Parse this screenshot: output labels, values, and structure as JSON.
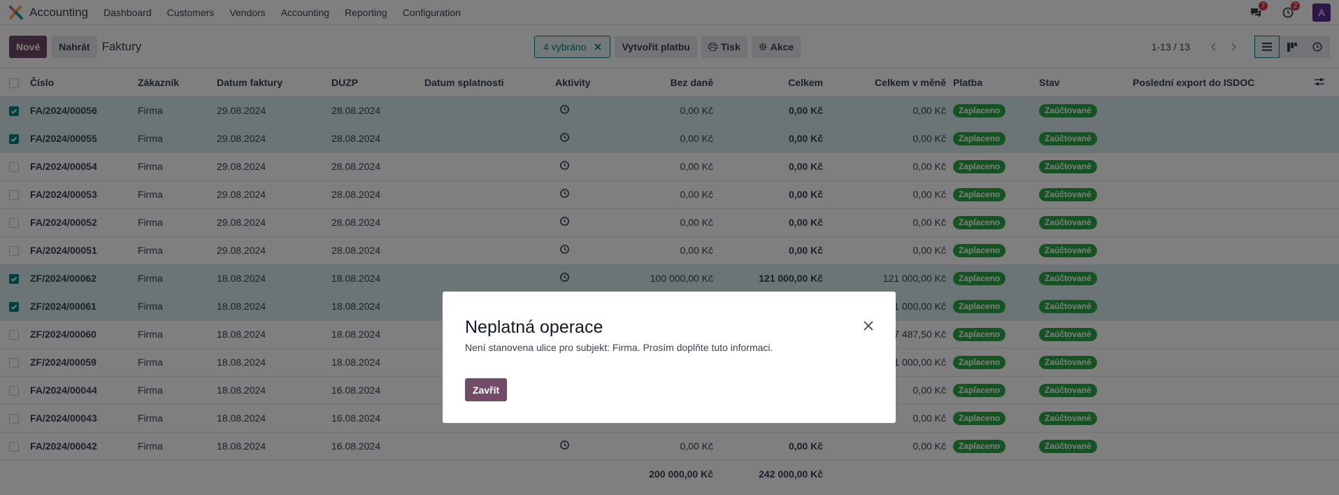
{
  "navbar": {
    "app_name": "Accounting",
    "menu": [
      "Dashboard",
      "Customers",
      "Vendors",
      "Accounting",
      "Reporting",
      "Configuration"
    ],
    "messages_count": "7",
    "activities_count": "2",
    "avatar_letter": "A"
  },
  "control": {
    "new_label": "Nové",
    "upload_label": "Nahrát",
    "breadcrumb": "Faktury",
    "selected_label": "4 vybráno",
    "create_payment_label": "Vytvořit platbu",
    "print_label": "Tisk",
    "action_label": "Akce",
    "pager": "1-13 / 13"
  },
  "table": {
    "columns": [
      "Číslo",
      "Zákazník",
      "Datum faktury",
      "DUZP",
      "Datum splatnosti",
      "Aktivity",
      "Bez daně",
      "Celkem",
      "Celkem v měně",
      "Platba",
      "Stav",
      "Poslední export do ISDOC"
    ],
    "rows": [
      {
        "selected": true,
        "number": "FA/2024/00056",
        "customer": "Firma",
        "invoice_date": "29.08.2024",
        "duzp": "28.08.2024",
        "untaxed": "0,00 Kč",
        "total": "0,00 Kč",
        "total_currency": "0,00 Kč",
        "payment": "Zaplaceno",
        "state": "Zaúčtované"
      },
      {
        "selected": true,
        "number": "FA/2024/00055",
        "customer": "Firma",
        "invoice_date": "29.08.2024",
        "duzp": "28.08.2024",
        "untaxed": "0,00 Kč",
        "total": "0,00 Kč",
        "total_currency": "0,00 Kč",
        "payment": "Zaplaceno",
        "state": "Zaúčtované"
      },
      {
        "selected": false,
        "number": "FA/2024/00054",
        "customer": "Firma",
        "invoice_date": "29.08.2024",
        "duzp": "28.08.2024",
        "untaxed": "0,00 Kč",
        "total": "0,00 Kč",
        "total_currency": "0,00 Kč",
        "payment": "Zaplaceno",
        "state": "Zaúčtované"
      },
      {
        "selected": false,
        "number": "FA/2024/00053",
        "customer": "Firma",
        "invoice_date": "29.08.2024",
        "duzp": "28.08.2024",
        "untaxed": "0,00 Kč",
        "total": "0,00 Kč",
        "total_currency": "0,00 Kč",
        "payment": "Zaplaceno",
        "state": "Zaúčtované"
      },
      {
        "selected": false,
        "number": "FA/2024/00052",
        "customer": "Firma",
        "invoice_date": "29.08.2024",
        "duzp": "28.08.2024",
        "untaxed": "0,00 Kč",
        "total": "0,00 Kč",
        "total_currency": "0,00 Kč",
        "payment": "Zaplaceno",
        "state": "Zaúčtované"
      },
      {
        "selected": false,
        "number": "FA/2024/00051",
        "customer": "Firma",
        "invoice_date": "29.08.2024",
        "duzp": "28.08.2024",
        "untaxed": "0,00 Kč",
        "total": "0,00 Kč",
        "total_currency": "0,00 Kč",
        "payment": "Zaplaceno",
        "state": "Zaúčtované"
      },
      {
        "selected": true,
        "number": "ZF/2024/00062",
        "customer": "Firma",
        "invoice_date": "18.08.2024",
        "duzp": "18.08.2024",
        "untaxed": "100 000,00 Kč",
        "total": "121 000,00 Kč",
        "total_currency": "121 000,00 Kč",
        "payment": "Zaplaceno",
        "state": "Zaúčtované"
      },
      {
        "selected": true,
        "number": "ZF/2024/00061",
        "customer": "Firma",
        "invoice_date": "18.08.2024",
        "duzp": "18.08.2024",
        "untaxed": "",
        "total": "",
        "total_currency": "121 000,00 Kč",
        "payment": "Zaplaceno",
        "state": "Zaúčtované"
      },
      {
        "selected": false,
        "number": "ZF/2024/00060",
        "customer": "Firma",
        "invoice_date": "18.08.2024",
        "duzp": "18.08.2024",
        "untaxed": "",
        "total": "",
        "total_currency": "47 487,50 Kč",
        "payment": "Zaplaceno",
        "state": "Zaúčtované"
      },
      {
        "selected": false,
        "number": "ZF/2024/00059",
        "customer": "Firma",
        "invoice_date": "18.08.2024",
        "duzp": "18.08.2024",
        "untaxed": "",
        "total": "",
        "total_currency": "121 000,00 Kč",
        "payment": "Zaplaceno",
        "state": "Zaúčtované"
      },
      {
        "selected": false,
        "number": "FA/2024/00044",
        "customer": "Firma",
        "invoice_date": "18.08.2024",
        "duzp": "16.08.2024",
        "untaxed": "",
        "total": "",
        "total_currency": "0,00 Kč",
        "payment": "Zaplaceno",
        "state": "Zaúčtované"
      },
      {
        "selected": false,
        "number": "FA/2024/00043",
        "customer": "Firma",
        "invoice_date": "18.08.2024",
        "duzp": "16.08.2024",
        "untaxed": "",
        "total": "",
        "total_currency": "0,00 Kč",
        "payment": "Zaplaceno",
        "state": "Zaúčtované"
      },
      {
        "selected": false,
        "number": "FA/2024/00042",
        "customer": "Firma",
        "invoice_date": "18.08.2024",
        "duzp": "16.08.2024",
        "untaxed": "0,00 Kč",
        "total": "0,00 Kč",
        "total_currency": "0,00 Kč",
        "payment": "Zaplaceno",
        "state": "Zaúčtované"
      }
    ],
    "totals": {
      "untaxed": "200 000,00 Kč",
      "total": "242 000,00 Kč"
    }
  },
  "modal": {
    "title": "Neplatná operace",
    "message": "Není stanovena ulice pro subjekt: Firma. Prosím doplňte tuto informaci.",
    "close_label": "Zavřít"
  },
  "colors": {
    "primary": "#714b67",
    "accent": "#017e84",
    "badge_green": "#28a745"
  }
}
